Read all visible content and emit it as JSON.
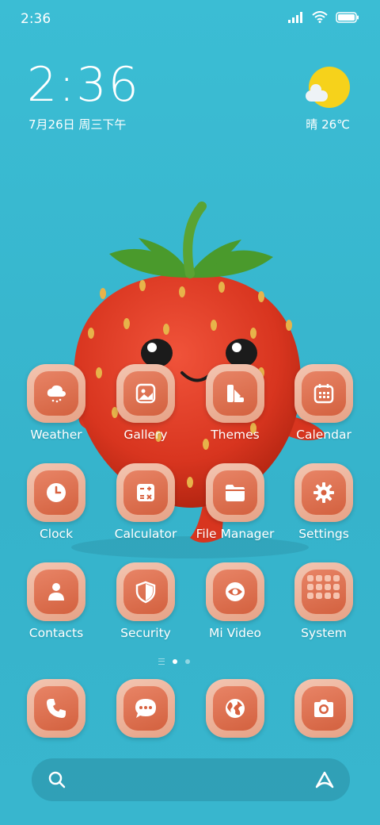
{
  "status_bar": {
    "time": "2:36"
  },
  "clock_widget": {
    "time": "2:36",
    "date": "7月26日 周三下午"
  },
  "weather_widget": {
    "text": "晴 26℃",
    "icon": "sunny-cloud-icon"
  },
  "apps": [
    {
      "label": "Weather",
      "icon": "weather-icon"
    },
    {
      "label": "Gallery",
      "icon": "gallery-icon"
    },
    {
      "label": "Themes",
      "icon": "themes-icon"
    },
    {
      "label": "Calendar",
      "icon": "calendar-icon"
    },
    {
      "label": "Clock",
      "icon": "clock-icon"
    },
    {
      "label": "Calculator",
      "icon": "calculator-icon"
    },
    {
      "label": "File Manager",
      "icon": "folder-icon"
    },
    {
      "label": "Settings",
      "icon": "gear-icon"
    },
    {
      "label": "Contacts",
      "icon": "contacts-icon"
    },
    {
      "label": "Security",
      "icon": "shield-icon"
    },
    {
      "label": "Mi Video",
      "icon": "eye-icon"
    },
    {
      "label": "System",
      "icon": "folder-grid-icon"
    }
  ],
  "dock": [
    {
      "icon": "phone-icon"
    },
    {
      "icon": "messages-icon"
    },
    {
      "icon": "browser-icon"
    },
    {
      "icon": "camera-icon"
    }
  ],
  "page_indicator": {
    "pages": 2,
    "active": 1
  },
  "colors": {
    "background": "#3ab9d0",
    "icon_outer": "#f3c5b1",
    "icon_inner": "#e07350",
    "sun": "#f6d21b"
  }
}
